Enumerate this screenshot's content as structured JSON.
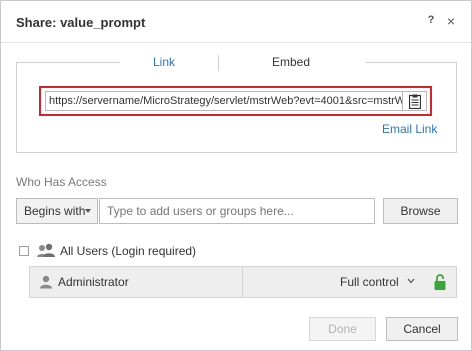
{
  "dialog": {
    "title": "Share: value_prompt",
    "help_label": "?",
    "close_label": "×"
  },
  "tabs": [
    {
      "label": "Link",
      "active": true
    },
    {
      "label": "Embed",
      "active": false
    }
  ],
  "link": {
    "url": "https://servername/MicroStrategy/servlet/mstrWeb?evt=4001&src=mstrWe",
    "copy_icon": "clipboard-icon",
    "email_link_label": "Email Link"
  },
  "access": {
    "section_label": "Who Has Access",
    "match_mode": "Begins with",
    "search_placeholder": "Type to add users or groups here...",
    "browse_label": "Browse",
    "all_users_label": "All Users (Login required)",
    "all_users_checked": false,
    "entries": [
      {
        "name": "Administrator",
        "permission": "Full control",
        "lock_icon": "unlocked-padlock-icon"
      }
    ]
  },
  "footer": {
    "done_label": "Done",
    "cancel_label": "Cancel"
  },
  "colors": {
    "accent_link": "#2a73c9",
    "highlight_outline": "#d6232c",
    "lock_green": "#3aa63a"
  }
}
